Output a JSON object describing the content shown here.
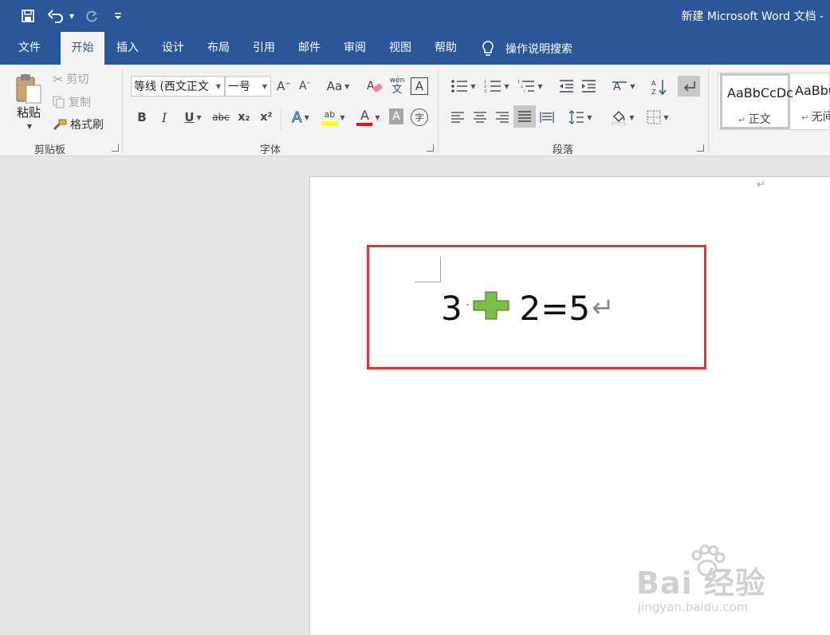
{
  "titlebar": {
    "doc_title": "新建 Microsoft Word 文档 -",
    "qat": {
      "save_icon": "save-icon",
      "undo_icon": "undo-icon",
      "redo_icon": "redo-icon",
      "customize_icon": "customize-qat-icon"
    }
  },
  "tabs": [
    {
      "label": "文件"
    },
    {
      "label": "开始"
    },
    {
      "label": "插入"
    },
    {
      "label": "设计"
    },
    {
      "label": "布局"
    },
    {
      "label": "引用"
    },
    {
      "label": "邮件"
    },
    {
      "label": "审阅"
    },
    {
      "label": "视图"
    },
    {
      "label": "帮助"
    }
  ],
  "active_tab": "开始",
  "tell_me": {
    "label": "操作说明搜索",
    "icon": "lightbulb-icon"
  },
  "clipboard": {
    "group_label": "剪贴板",
    "paste_label": "粘贴",
    "cut_label": "剪切",
    "copy_label": "复制",
    "format_painter_label": "格式刷"
  },
  "font": {
    "group_label": "字体",
    "font_name": "等线 (西文正文",
    "font_size": "一号",
    "grow_font_label": "A",
    "shrink_font_label": "A",
    "change_case_label": "Aa",
    "phonetic_top": "wén",
    "phonetic_bottom": "文",
    "char_border_label": "A",
    "bold_label": "B",
    "italic_label": "I",
    "underline_label": "U",
    "strike_label": "abc",
    "subscript_label": "x₂",
    "superscript_label": "x²",
    "text_effect_label": "A",
    "highlight_label": "ab",
    "font_color_label": "A",
    "char_shading_label": "A",
    "enclose_label": "字"
  },
  "paragraph": {
    "group_label": "段落"
  },
  "styles": [
    {
      "sample": "AaBbCcDc",
      "name": "正文"
    },
    {
      "sample": "AaBbC",
      "name": "无间"
    }
  ],
  "document": {
    "header_mark": "↵",
    "eq_left": "3",
    "eq_space_dot": "·",
    "eq_right": "2=5",
    "para_mark": "↵"
  },
  "watermark": {
    "main": "Bai 经验",
    "sub": "jingyan.baidu.com"
  },
  "colors": {
    "title_bar": "#2b579a",
    "ribbon_bg": "#f3f3f3",
    "highlight_box": "#e03535",
    "plus_fill": "#7ac143",
    "font_color_underline": "#e81123",
    "highlight_yellow": "#ffff00"
  }
}
